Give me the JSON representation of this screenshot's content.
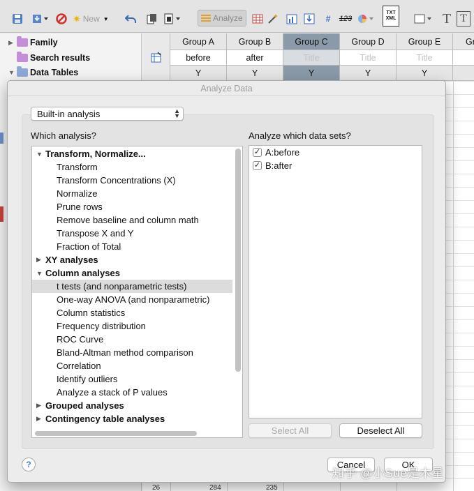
{
  "toolbar": {
    "new_label": "New",
    "analyze_label": "Analyze",
    "numeric_glyph": "123",
    "txt_label": "TXT",
    "xml_label": "XML",
    "text_tool_glyph": "T"
  },
  "navigator": {
    "items": [
      {
        "label": "Family",
        "expanded": false
      },
      {
        "label": "Search results",
        "expanded": null
      },
      {
        "label": "Data Tables",
        "expanded": true
      }
    ]
  },
  "sheet": {
    "columns": [
      {
        "group": "Group A",
        "title": "before",
        "placeholder": false,
        "type": "Y"
      },
      {
        "group": "Group B",
        "title": "after",
        "placeholder": false,
        "type": "Y"
      },
      {
        "group": "Group C",
        "title": "Title",
        "placeholder": true,
        "type": "Y"
      },
      {
        "group": "Group D",
        "title": "Title",
        "placeholder": true,
        "type": "Y"
      },
      {
        "group": "Group E",
        "title": "Title",
        "placeholder": true,
        "type": "Y"
      },
      {
        "group": "Gr",
        "title": "",
        "placeholder": false,
        "type": ""
      }
    ],
    "last_row": {
      "row_number": "26",
      "a": "284",
      "b": "235"
    }
  },
  "dialog": {
    "title": "Analyze Data",
    "analysis_type": "Built-in analysis",
    "which_analysis_label": "Which analysis?",
    "which_datasets_label": "Analyze which data sets?",
    "analysis_tree": [
      {
        "label": "Transform, Normalize...",
        "expanded": true,
        "children": [
          "Transform",
          "Transform Concentrations (X)",
          "Normalize",
          "Prune rows",
          "Remove baseline and column math",
          "Transpose X and Y",
          "Fraction of Total"
        ]
      },
      {
        "label": "XY analyses",
        "expanded": false,
        "children": []
      },
      {
        "label": "Column analyses",
        "expanded": true,
        "children": [
          "t tests (and nonparametric tests)",
          "One-way ANOVA (and nonparametric)",
          "Column statistics",
          "Frequency distribution",
          "ROC Curve",
          "Bland-Altman method comparison",
          "Correlation",
          "Identify outliers",
          "Analyze a stack of P values"
        ]
      },
      {
        "label": "Grouped analyses",
        "expanded": false,
        "children": []
      },
      {
        "label": "Contingency table analyses",
        "expanded": false,
        "children": []
      }
    ],
    "selected_analysis": "t tests (and nonparametric tests)",
    "datasets": [
      {
        "label": "A:before",
        "checked": true
      },
      {
        "label": "B:after",
        "checked": true
      }
    ],
    "select_all_label": "Select All",
    "deselect_all_label": "Deselect All",
    "help_label": "?",
    "cancel_label": "Cancel",
    "ok_label": "OK"
  },
  "watermark": "知乎 @小Sue是木星",
  "colors": {
    "selected_column": "#8a9aa8",
    "folder": "#c48fd8",
    "accent": "#e8a020"
  }
}
